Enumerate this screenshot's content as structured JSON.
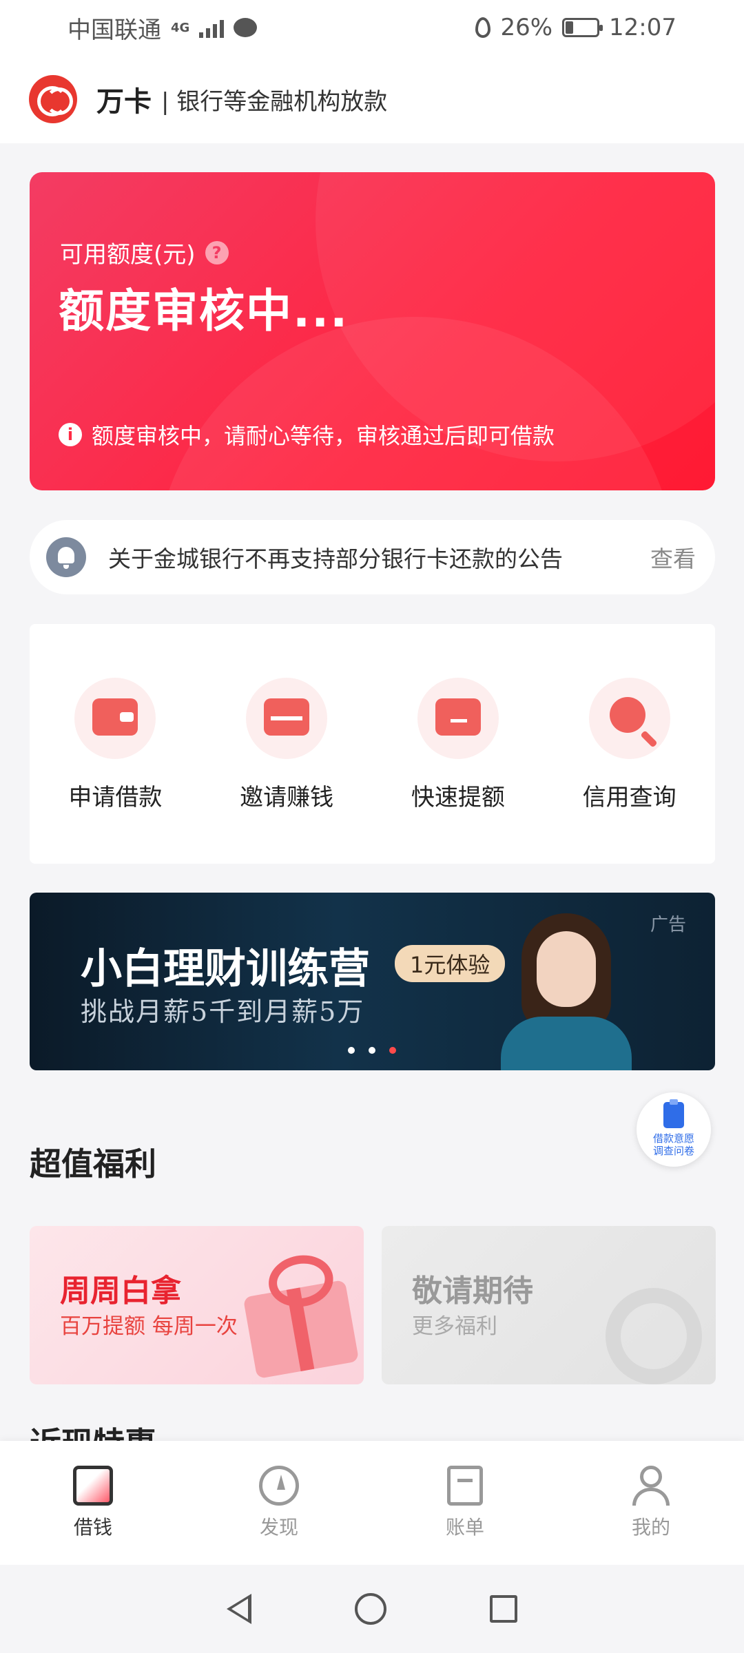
{
  "status_bar": {
    "carrier": "中国联通",
    "network": "4G",
    "battery_percent": "26%",
    "battery_level": 0.26,
    "time": "12:07"
  },
  "header": {
    "brand": "万卡",
    "subtitle": "| 银行等金融机构放款"
  },
  "credit_card": {
    "label": "可用额度(元)",
    "status": "额度审核中...",
    "tip": "额度审核中，请耐心等待，审核通过后即可借款"
  },
  "notice": {
    "text": "关于金城银行不再支持部分银行卡还款的公告",
    "link": "查看"
  },
  "actions": [
    {
      "label": "申请借款",
      "icon": "wallet-icon"
    },
    {
      "label": "邀请赚钱",
      "icon": "envelope-icon"
    },
    {
      "label": "快速提额",
      "icon": "box-icon"
    },
    {
      "label": "信用查询",
      "icon": "search-icon"
    }
  ],
  "banner": {
    "title": "小白理财训练营",
    "badge": "1元体验",
    "subtitle": "挑战月薪5千到月薪5万",
    "ad_tag": "广告",
    "slides": 3,
    "active_slide": 3
  },
  "survey": {
    "line1": "借款意愿",
    "line2": "调查问卷"
  },
  "benefits": {
    "section_title": "超值福利",
    "items": [
      {
        "title": "周周白拿",
        "subtitle": "百万提额 每周一次"
      },
      {
        "title": "敬请期待",
        "subtitle": "更多福利"
      }
    ],
    "next_section_title": "近现特惠"
  },
  "bottom_nav": [
    {
      "label": "借钱",
      "icon": "wallet-icon",
      "active": true
    },
    {
      "label": "发现",
      "icon": "compass-icon",
      "active": false
    },
    {
      "label": "账单",
      "icon": "bill-icon",
      "active": false
    },
    {
      "label": "我的",
      "icon": "user-icon",
      "active": false
    }
  ],
  "colors": {
    "brand_red": "#ff2440",
    "accent_red": "#e8232f",
    "background": "#f5f5f7"
  }
}
